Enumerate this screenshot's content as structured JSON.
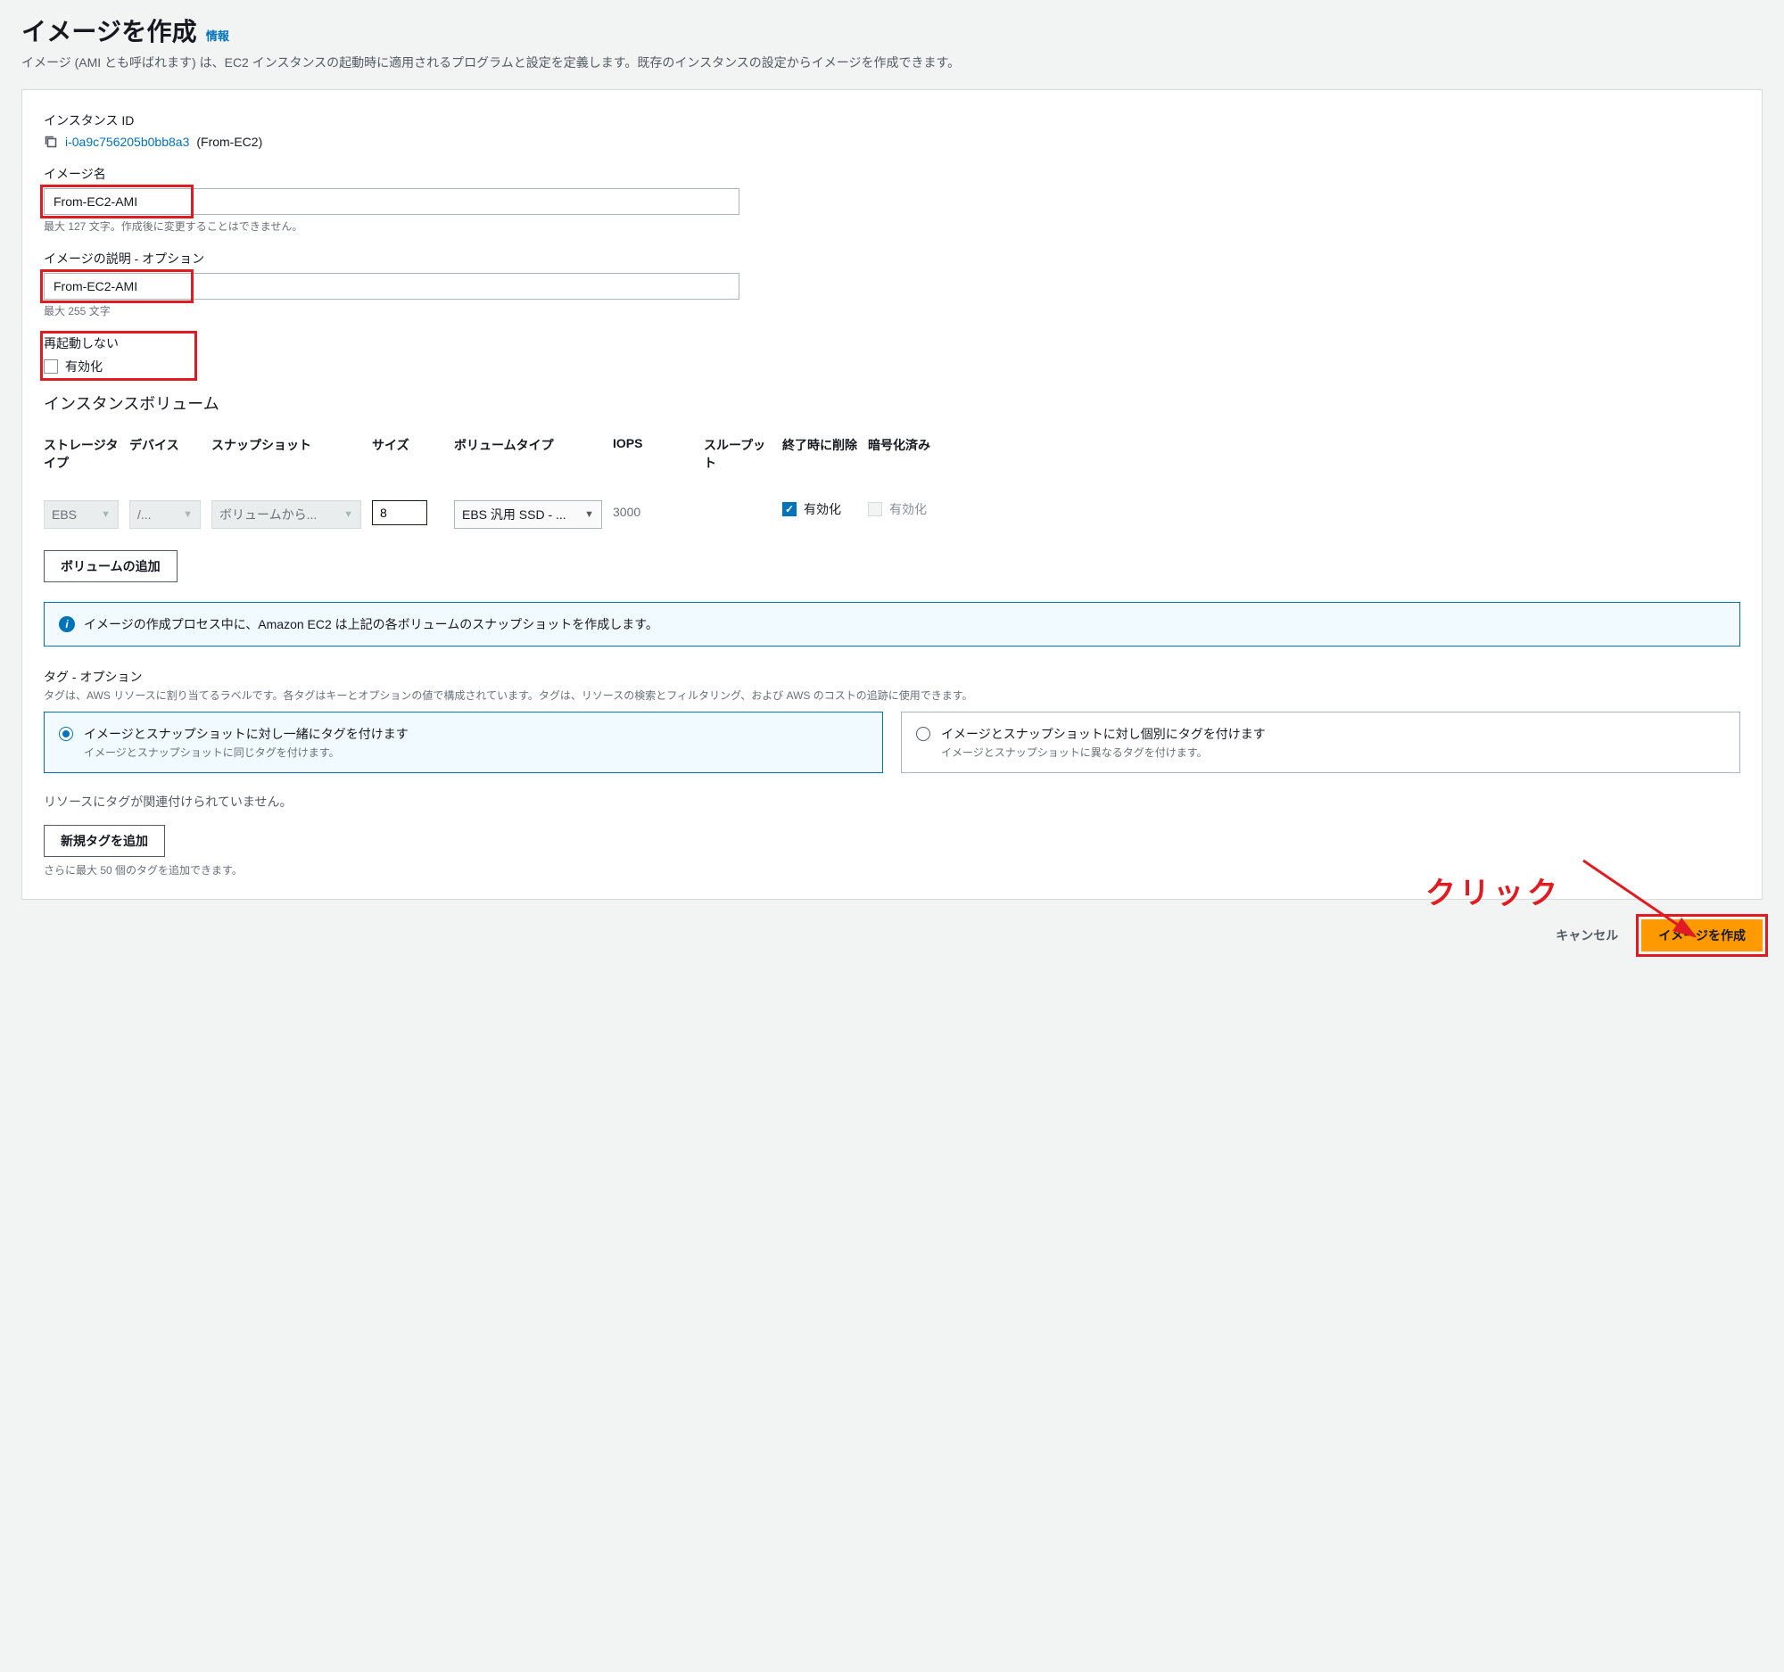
{
  "header": {
    "title": "イメージを作成",
    "info_link": "情報",
    "description": "イメージ (AMI とも呼ばれます) は、EC2 インスタンスの起動時に適用されるプログラムと設定を定義します。既存のインスタンスの設定からイメージを作成できます。"
  },
  "instance": {
    "label": "インスタンス ID",
    "id": "i-0a9c756205b0bb8a3",
    "name": "(From-EC2)"
  },
  "image_name": {
    "label": "イメージ名",
    "value": "From-EC2-AMI",
    "helper": "最大 127 文字。作成後に変更することはできません。"
  },
  "image_desc": {
    "label": "イメージの説明 - オプション",
    "value": "From-EC2-AMI",
    "helper": "最大 255 文字"
  },
  "no_reboot": {
    "label": "再起動しない",
    "checkbox_label": "有効化",
    "checked": false
  },
  "volumes": {
    "heading": "インスタンスボリューム",
    "headers": {
      "storage_type": "ストレージタイプ",
      "device": "デバイス",
      "snapshot": "スナップショット",
      "size": "サイズ",
      "volume_type": "ボリュームタイプ",
      "iops": "IOPS",
      "throughput": "スループット",
      "delete_on_term": "終了時に削除",
      "encrypted": "暗号化済み"
    },
    "row": {
      "storage_type": "EBS",
      "device": "/...",
      "snapshot": "ボリュームから...",
      "size": "8",
      "volume_type": "EBS 汎用 SSD - ...",
      "iops": "3000",
      "throughput": "",
      "delete_label": "有効化",
      "delete_checked": true,
      "encrypted_label": "有効化",
      "encrypted_checked": false
    },
    "add_button": "ボリュームの追加"
  },
  "info_banner": "イメージの作成プロセス中に、Amazon EC2 は上記の各ボリュームのスナップショットを作成します。",
  "tags": {
    "title": "タグ - オプション",
    "description": "タグは、AWS リソースに割り当てるラベルです。各タグはキーとオプションの値で構成されています。タグは、リソースの検索とフィルタリング、および AWS のコストの追跡に使用できます。",
    "mode_together": {
      "title": "イメージとスナップショットに対し一緒にタグを付けます",
      "sub": "イメージとスナップショットに同じタグを付けます。"
    },
    "mode_separate": {
      "title": "イメージとスナップショットに対し個別にタグを付けます",
      "sub": "イメージとスナップショットに異なるタグを付けます。"
    },
    "none_text": "リソースにタグが関連付けられていません。",
    "add_button": "新規タグを追加",
    "hint": "さらに最大 50 個のタグを追加できます。"
  },
  "footer": {
    "cancel": "キャンセル",
    "create": "イメージを作成"
  },
  "annotation": {
    "click_label": "クリック"
  }
}
